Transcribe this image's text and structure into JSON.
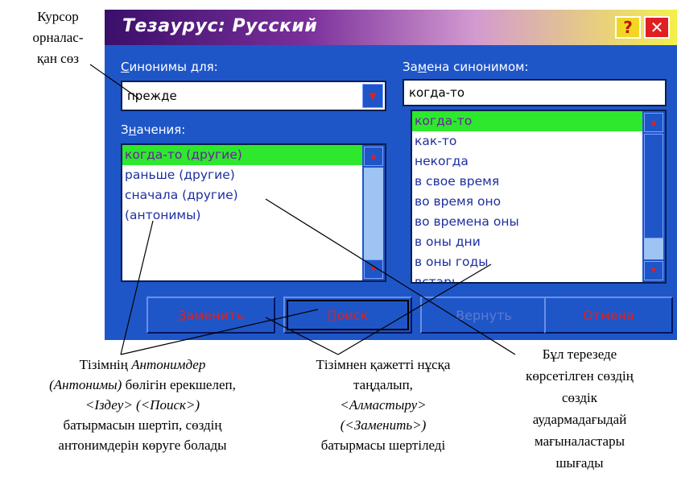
{
  "dialog": {
    "title": "Тезаурус: Русский",
    "help_label": "?",
    "close_label": "✕"
  },
  "left": {
    "synonyms_for_label_u": "С",
    "synonyms_for_label_rest": "инонимы для:",
    "synonyms_for_value": "прежде",
    "meanings_label_pre": "З",
    "meanings_label_u": "н",
    "meanings_label_rest": "ачения:",
    "meanings": [
      "когда-то (другие)",
      "раньше (другие)",
      "сначала (другие)",
      "(антонимы)"
    ]
  },
  "right": {
    "replace_label_pre": "За",
    "replace_label_u": "м",
    "replace_label_rest": "ена синонимом:",
    "replace_value": "когда-то",
    "synonyms": [
      "когда-то",
      "как-то",
      "некогда",
      "в свое время",
      "во время оно",
      "во времена оны",
      "в оны дни",
      "в оны годы",
      "встарь"
    ]
  },
  "buttons": {
    "replace_u": "З",
    "replace_rest": "аменить",
    "search_u": "П",
    "search_rest": "оиск",
    "restore_label": "Вернуть",
    "cancel_label": "Отмена"
  },
  "annotations": {
    "cursor_word": [
      "Курсор",
      "орналас-",
      "қан сөз"
    ],
    "antonyms_note_l1_pre": "Тізімнің ",
    "antonyms_note_l1_it": "Антонимдер",
    "antonyms_note_l2_it": "(Антонимы)",
    "antonyms_note_l2_rest": " бөлігін ерекшелеп,",
    "antonyms_note_l3": "<Іздеу>  (<Поиск>)",
    "antonyms_note_l4": "батырмасын шертіп,  сөздің",
    "antonyms_note_l5": "антонимдерін көруге болады",
    "replace_note_l1": "Тізімнен қажетті нұсқа",
    "replace_note_l2": "таңдалып,",
    "replace_note_l3": "<Алмастыру>",
    "replace_note_l4": "(<Заменить>)",
    "replace_note_l5": "батырмасы шертіледі",
    "meaning_note": [
      "Бұл терезеде",
      "көрсетілген сөздің",
      "сөздік",
      "аудармадағыдай",
      "мағыналастары",
      "шығады"
    ]
  },
  "colors": {
    "dialog_bg": "#1e56c8",
    "selection": "#2ee82e",
    "item_text": "#1e2fa0",
    "accent_red": "#e02020"
  }
}
